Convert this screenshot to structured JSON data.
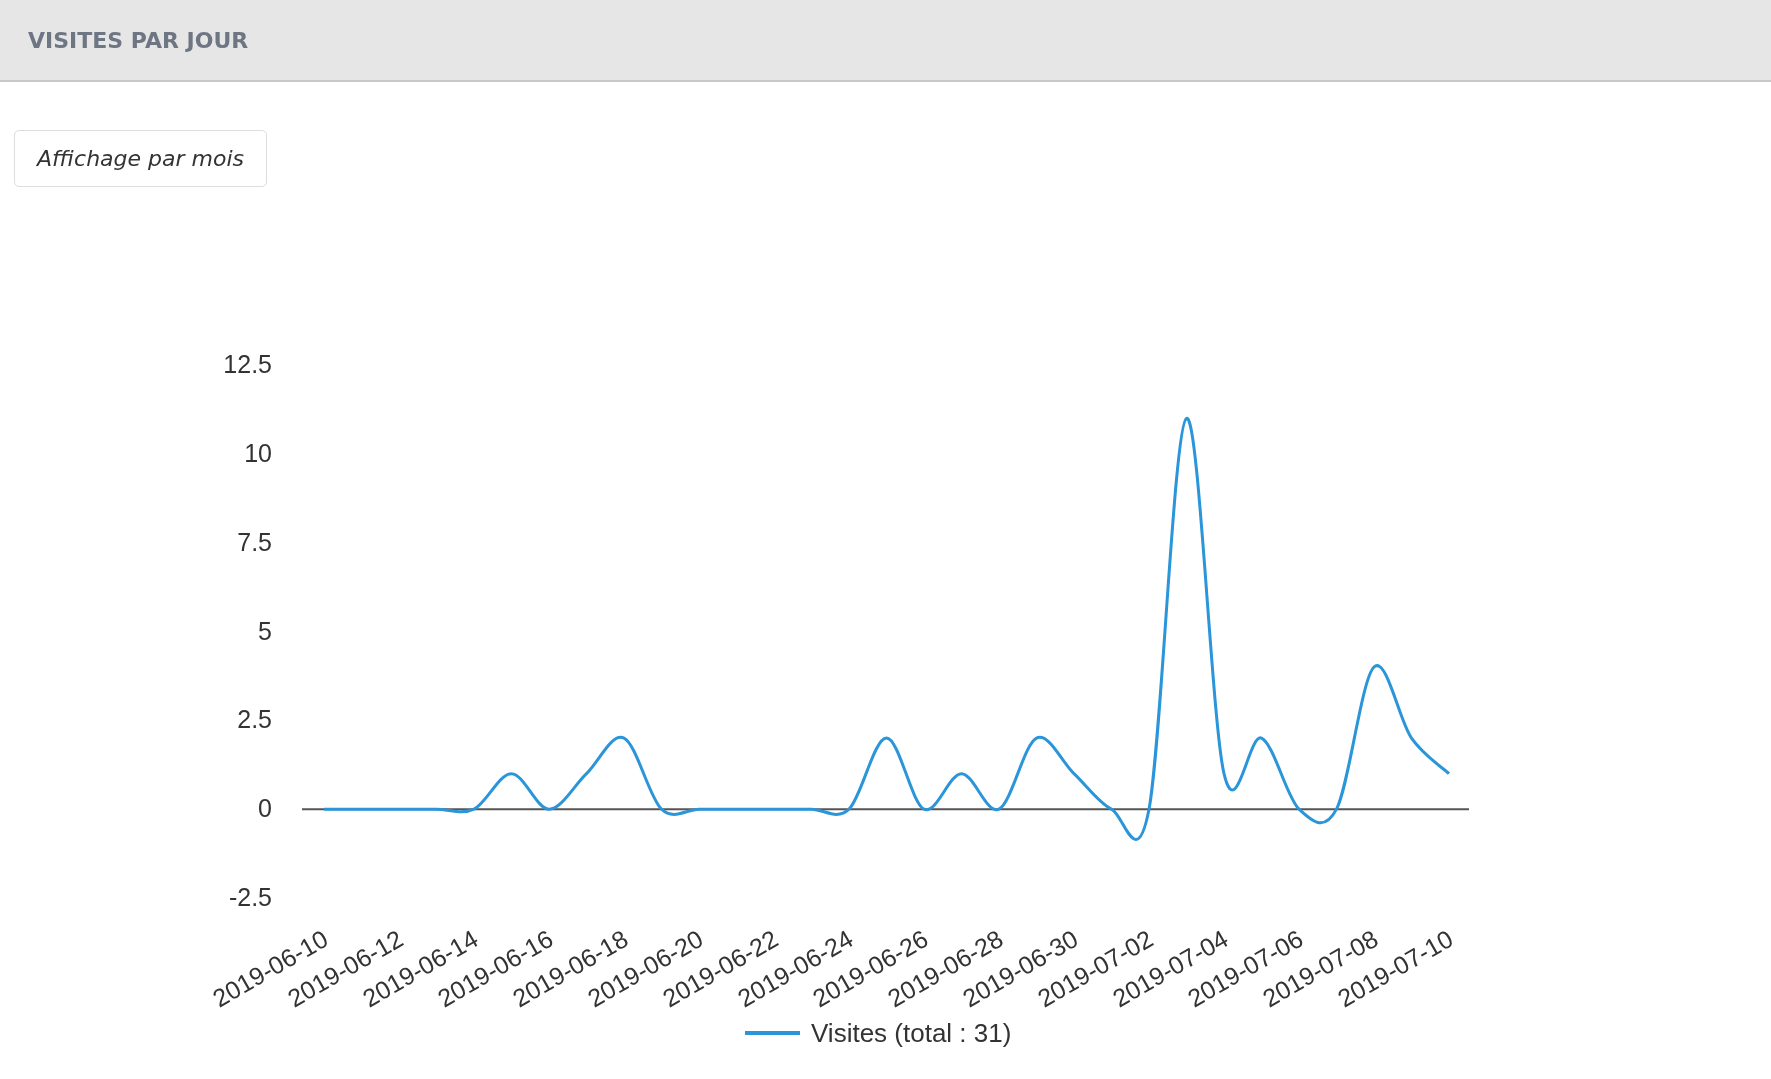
{
  "header": {
    "title": "VISITES PAR JOUR"
  },
  "toggle_button": {
    "label": "Affichage par mois"
  },
  "chart": {
    "chart_data": {
      "type": "line",
      "categories": [
        "2019-06-10",
        null,
        "2019-06-12",
        null,
        "2019-06-14",
        null,
        "2019-06-16",
        null,
        "2019-06-18",
        null,
        "2019-06-20",
        null,
        "2019-06-22",
        null,
        "2019-06-24",
        null,
        "2019-06-26",
        null,
        "2019-06-28",
        null,
        "2019-06-30",
        null,
        "2019-07-02",
        null,
        "2019-07-04",
        null,
        "2019-07-06",
        null,
        "2019-07-08",
        null,
        "2019-07-10"
      ],
      "series": [
        {
          "name": "Visites (total : 31)",
          "color": "#2b95d9",
          "values": [
            0,
            0,
            0,
            0,
            0,
            1,
            0,
            1,
            2,
            0,
            0,
            0,
            0,
            0,
            0,
            2,
            0,
            1,
            0,
            2,
            1,
            0,
            0,
            11,
            1,
            2,
            0,
            0,
            4,
            2,
            1
          ]
        }
      ],
      "ylim": [
        -2.5,
        12.5
      ],
      "yticks": [
        {
          "value": -2.5,
          "label": "-2.5"
        },
        {
          "value": 0,
          "label": "0"
        },
        {
          "value": 2.5,
          "label": "2.5"
        },
        {
          "value": 5,
          "label": "5"
        },
        {
          "value": 7.5,
          "label": "7.5"
        },
        {
          "value": 10,
          "label": "10"
        },
        {
          "value": 12.5,
          "label": "12.5"
        }
      ]
    }
  }
}
